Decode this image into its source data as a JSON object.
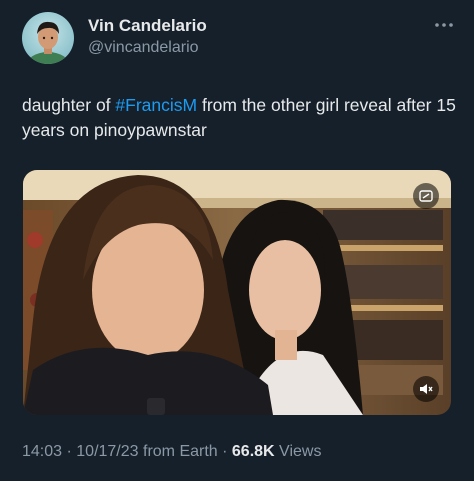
{
  "author": {
    "display_name": "Vin Candelario",
    "handle": "@vincandelario",
    "avatar_icon": "profile-photo"
  },
  "more_icon": "more-horizontal-icon",
  "tweet": {
    "text_before": "daughter of ",
    "hashtag": "#FrancisM",
    "text_after": " from the other girl reveal after 15 years on pinoypawnstar"
  },
  "media": {
    "type": "video",
    "top_badge_icon": "gif-settings-icon",
    "bottom_badge_icon": "volume-muted-icon"
  },
  "meta": {
    "time": "14:03",
    "sep1": " · ",
    "date": "10/17/23",
    "source": " from Earth",
    "sep2": " · ",
    "views_count": "66.8K",
    "views_label": " Views"
  },
  "colors": {
    "background": "#15202b",
    "text": "#e7e9ea",
    "secondary": "#8b98a5",
    "link": "#1d9bf0"
  }
}
